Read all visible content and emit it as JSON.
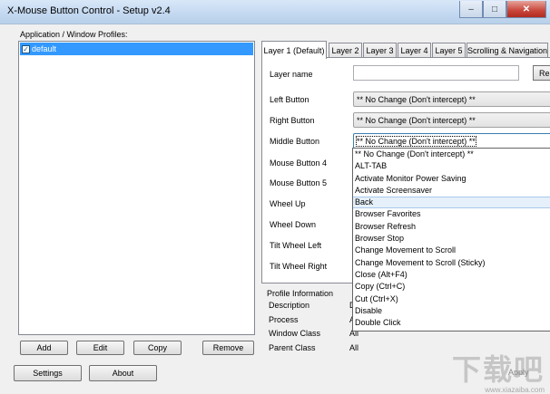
{
  "window": {
    "title": "X-Mouse Button Control - Setup v2.4",
    "caption_icons": [
      "minimize-icon",
      "maximize-icon",
      "close-icon"
    ],
    "caption_glyphs": {
      "minimize": "–",
      "maximize": "□",
      "close": "✕"
    }
  },
  "profiles": {
    "label": "Application / Window Profiles:",
    "items": [
      {
        "name": "default",
        "checked": true,
        "check_glyph": "✓"
      }
    ]
  },
  "profile_buttons": {
    "add": "Add",
    "edit": "Edit",
    "copy": "Copy",
    "remove": "Remove"
  },
  "bottom_buttons": {
    "settings": "Settings",
    "about": "About",
    "apply": "Apply"
  },
  "tabs": [
    {
      "label": "Layer 1 (Default)",
      "active": true
    },
    {
      "label": "Layer 2"
    },
    {
      "label": "Layer 3"
    },
    {
      "label": "Layer 4"
    },
    {
      "label": "Layer 5"
    },
    {
      "label": "Scrolling & Navigation"
    }
  ],
  "layer": {
    "layer_name_label": "Layer name",
    "layer_name_value": "",
    "reset_label": "Re",
    "rows": [
      {
        "label": "Left Button",
        "value": "** No Change (Don't intercept) **"
      },
      {
        "label": "Right Button",
        "value": "** No Change (Don't intercept) **"
      },
      {
        "label": "Middle Button",
        "value": "** No Change (Don't intercept) **"
      },
      {
        "label": "Mouse Button 4",
        "value": ""
      },
      {
        "label": "Mouse Button 5",
        "value": ""
      },
      {
        "label": "Wheel Up",
        "value": ""
      },
      {
        "label": "Wheel Down",
        "value": ""
      },
      {
        "label": "Tilt Wheel Left",
        "value": ""
      },
      {
        "label": "Tilt Wheel Right",
        "value": ""
      }
    ]
  },
  "dropdown_options": [
    "** No Change (Don't intercept) **",
    "ALT-TAB",
    "Activate Monitor Power Saving",
    "Activate Screensaver",
    "Back",
    "Browser Favorites",
    "Browser Refresh",
    "Browser Stop",
    "Change Movement to Scroll",
    "Change Movement to Scroll (Sticky)",
    "Close (Alt+F4)",
    "Copy (Ctrl+C)",
    "Cut (Ctrl+X)",
    "Disable",
    "Double Click"
  ],
  "dropdown_highlighted": "Back",
  "profile_info": {
    "heading": "Profile Information",
    "rows": [
      {
        "label": "Description",
        "value": "D"
      },
      {
        "label": "Process",
        "value": "A"
      },
      {
        "label": "Window Class",
        "value": "All"
      },
      {
        "label": "Parent Class",
        "value": "All"
      }
    ]
  },
  "watermark": {
    "text": "下载吧",
    "url": "www.xiazaiba.com"
  },
  "colors": {
    "selection": "#3399ff",
    "hover": "#e6f0fa",
    "titlebar": "#c3d8f0"
  }
}
